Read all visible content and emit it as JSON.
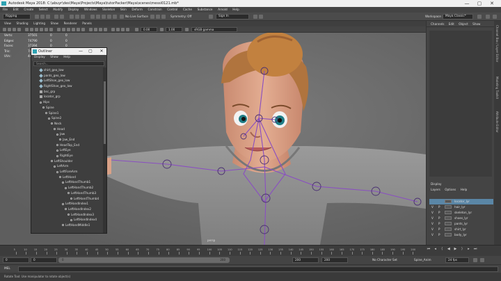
{
  "window": {
    "title": "Autodesk Maya 2018: C:\\abuyr\\des\\Maya\\Projects\\Maya\\tutorPacker\\Maya\\scenes\\messi0121.mb*",
    "min": "—",
    "max": "▢",
    "close": "✕"
  },
  "menubar": [
    "File",
    "Edit",
    "Create",
    "Select",
    "Modify",
    "Display",
    "Windows",
    "Skeleton",
    "Skin",
    "Deform",
    "Constrain",
    "Control",
    "Cache",
    "Substance",
    "Arnold",
    "Help"
  ],
  "shelf": {
    "mode": "Rigging",
    "no_live_surface": "No Live Surface",
    "symmetry": "Symmetry: Off",
    "sign_in": "Sign In",
    "workspace_label": "Workspace :",
    "workspace": "Maya Classic*"
  },
  "viewport_menu": [
    "View",
    "Shading",
    "Lighting",
    "Show",
    "Renderer",
    "Panels"
  ],
  "viewport_toolbar": {
    "value_a": "0.00",
    "value_b": "1.00",
    "colorspace": "sRGB gamma"
  },
  "hud": {
    "rows": [
      {
        "label": "Verts:",
        "v": "37501",
        "z": "0",
        "w": "0"
      },
      {
        "label": "Edges:",
        "v": "74790",
        "z": "0",
        "w": "0"
      },
      {
        "label": "Faces:",
        "v": "37394",
        "z": "0",
        "w": "0"
      },
      {
        "label": "Tris:",
        "v": "74692",
        "z": "0",
        "w": "0"
      },
      {
        "label": "UVs:",
        "v": "44407",
        "z": "0",
        "w": "0"
      }
    ]
  },
  "camera_label": "persp",
  "outliner": {
    "title": "Outliner",
    "menu": [
      "Display",
      "Show",
      "Help"
    ],
    "search_placeholder": "Search...",
    "items": [
      {
        "label": "shirt_geo_low",
        "indent": 1,
        "kind": "mesh"
      },
      {
        "label": "pants_geo_low",
        "indent": 1,
        "kind": "mesh"
      },
      {
        "label": "LeftShoe_geo_low",
        "indent": 1,
        "kind": "mesh"
      },
      {
        "label": "RightShoe_geo_low",
        "indent": 1,
        "kind": "mesh"
      },
      {
        "label": "bsc_grp",
        "indent": 1,
        "kind": "grp"
      },
      {
        "label": "locator_grp",
        "indent": 1,
        "kind": "grp"
      },
      {
        "label": "Hips",
        "indent": 1,
        "kind": "joint"
      },
      {
        "label": "Spine",
        "indent": 2,
        "kind": "joint"
      },
      {
        "label": "Spine1",
        "indent": 3,
        "kind": "joint"
      },
      {
        "label": "Spine2",
        "indent": 4,
        "kind": "joint"
      },
      {
        "label": "Neck",
        "indent": 5,
        "kind": "joint"
      },
      {
        "label": "Head",
        "indent": 6,
        "kind": "joint"
      },
      {
        "label": "Jaw",
        "indent": 7,
        "kind": "joint"
      },
      {
        "label": "Jaw_End",
        "indent": 8,
        "kind": "joint"
      },
      {
        "label": "HeadTop_End",
        "indent": 7,
        "kind": "joint"
      },
      {
        "label": "LeftEye",
        "indent": 7,
        "kind": "joint"
      },
      {
        "label": "RightEye",
        "indent": 7,
        "kind": "joint"
      },
      {
        "label": "LeftShoulder",
        "indent": 5,
        "kind": "joint"
      },
      {
        "label": "LeftArm",
        "indent": 6,
        "kind": "joint"
      },
      {
        "label": "LeftForeArm",
        "indent": 7,
        "kind": "joint"
      },
      {
        "label": "LeftHand",
        "indent": 8,
        "kind": "joint"
      },
      {
        "label": "LeftHandThumb1",
        "indent": 9,
        "kind": "joint"
      },
      {
        "label": "LeftHandThumb2",
        "indent": 10,
        "kind": "joint"
      },
      {
        "label": "LeftHandThumb3",
        "indent": 11,
        "kind": "joint"
      },
      {
        "label": "LeftHandThumb4",
        "indent": 12,
        "kind": "joint"
      },
      {
        "label": "LeftHandIndex1",
        "indent": 9,
        "kind": "joint"
      },
      {
        "label": "LeftHandIndex2",
        "indent": 10,
        "kind": "joint"
      },
      {
        "label": "LeftHandIndex3",
        "indent": 11,
        "kind": "joint"
      },
      {
        "label": "LeftHandIndex4",
        "indent": 12,
        "kind": "joint"
      },
      {
        "label": "LeftHandMiddle1",
        "indent": 9,
        "kind": "joint"
      }
    ]
  },
  "right_panel": {
    "tabs": [
      "Channels",
      "Edit",
      "Object",
      "Show"
    ],
    "display_tab": "Display",
    "layer_menu": [
      "Layers",
      "Options",
      "Help"
    ],
    "layers": [
      {
        "v": "",
        "p": "",
        "name": "locator_lyr",
        "selected": true
      },
      {
        "v": "V",
        "p": "P",
        "name": "hair_lyr",
        "selected": false
      },
      {
        "v": "V",
        "p": "P",
        "name": "skeleton_lyr",
        "selected": false
      },
      {
        "v": "V",
        "p": "P",
        "name": "shoes_lyr",
        "selected": false
      },
      {
        "v": "V",
        "p": "P",
        "name": "pants_lyr",
        "selected": false
      },
      {
        "v": "V",
        "p": "P",
        "name": "shirt_lyr",
        "selected": false
      },
      {
        "v": "V",
        "p": "P",
        "name": "body_lyr",
        "selected": false
      }
    ]
  },
  "side_tabs": [
    "Channel Box / Layer Editor",
    "Modeling Toolkit",
    "Attribute Editor"
  ],
  "timeline": {
    "ticks": [
      "5",
      "10",
      "15",
      "20",
      "25",
      "30",
      "35",
      "40",
      "45",
      "50",
      "55",
      "60",
      "65",
      "70",
      "75",
      "80",
      "85",
      "90",
      "95",
      "100",
      "105",
      "110",
      "115",
      "120",
      "125",
      "130",
      "135",
      "140",
      "145",
      "150",
      "155",
      "160",
      "165",
      "170",
      "175",
      "180",
      "185",
      "190",
      "195",
      "200"
    ]
  },
  "range": {
    "start": "0",
    "start2": "0",
    "slider_start": "0",
    "slider_end": "200",
    "end_inner": "200",
    "end_outer": "200",
    "character_set": "No Character Set",
    "anim_layer": "Spine_Anim",
    "fps": "24 fps"
  },
  "mel": {
    "label": "MEL"
  },
  "status": {
    "message": "Rotate Tool: Use manipulator to rotate object(s)"
  }
}
